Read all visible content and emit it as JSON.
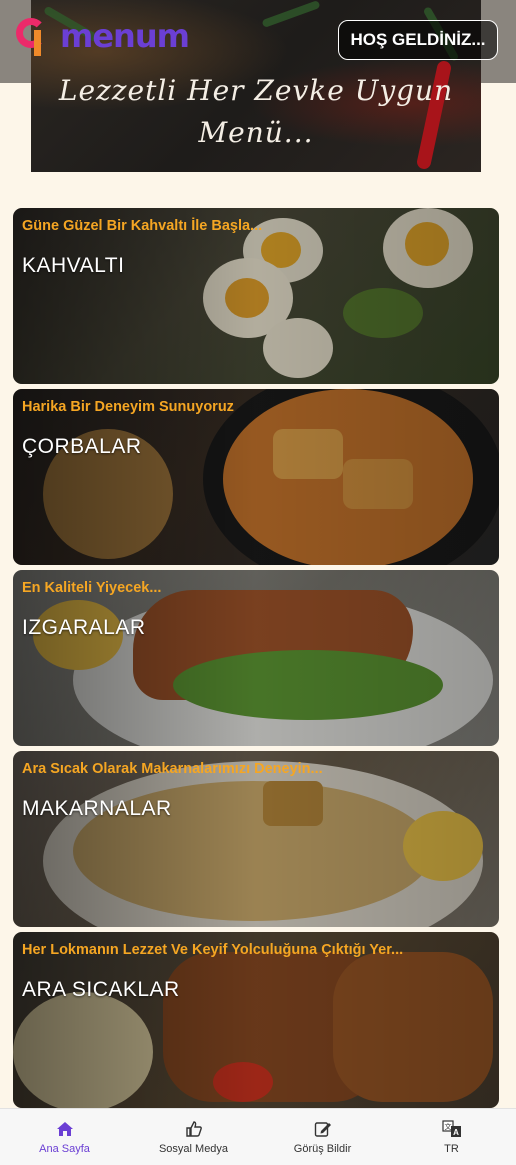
{
  "header": {
    "logo_text": "menum",
    "welcome_button": "HOŞ GELDİNİZ...",
    "hero_text_line1": "Lezzetli Her Zevke Uygun",
    "hero_text_line2": "Menü..."
  },
  "categories": [
    {
      "tagline": "Güne Güzel Bir Kahvaltı İle Başla...",
      "title": "KAHVALTI"
    },
    {
      "tagline": "Harika Bir Deneyim Sunuyoruz",
      "title": "ÇORBALAR"
    },
    {
      "tagline": "En Kaliteli Yiyecek...",
      "title": "IZGARALAR"
    },
    {
      "tagline": "Ara Sıcak Olarak Makarnalarımızı Deneyin...",
      "title": "MAKARNALAR"
    },
    {
      "tagline": "Her Lokmanın Lezzet Ve Keyif Yolculuğuna Çıktığı Yer...",
      "title": "ARA SICAKLAR"
    }
  ],
  "bottom_nav": [
    {
      "label": "Ana Sayfa",
      "icon": "home-icon",
      "active": true
    },
    {
      "label": "Sosyal Medya",
      "icon": "thumbs-up-icon",
      "active": false
    },
    {
      "label": "Görüş Bildir",
      "icon": "edit-icon",
      "active": false
    },
    {
      "label": "TR",
      "icon": "translate-icon",
      "active": false
    }
  ],
  "colors": {
    "accent": "#6b3fd4",
    "tagline": "#f5a623",
    "background": "#fdf6e9"
  }
}
